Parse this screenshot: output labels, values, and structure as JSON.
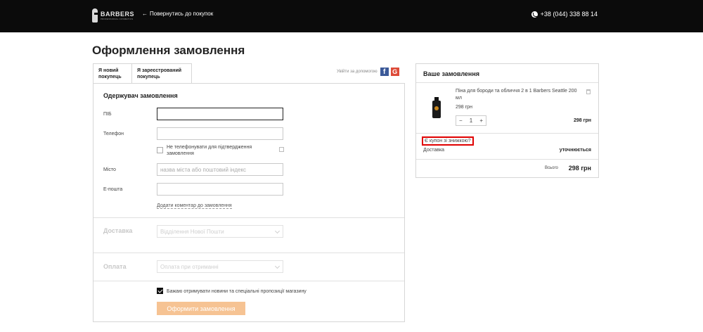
{
  "header": {
    "logo_main": "BARBERS",
    "logo_sub": "PROFESSIONAL COSMETICS",
    "back_label": "Повернутись до покупок",
    "phone": "+38 (044) 338 88 14"
  },
  "page": {
    "title": "Оформлення замовлення"
  },
  "tabs": [
    {
      "label": "Я новий покупець",
      "active": true
    },
    {
      "label": "Я зареєстрований покупець",
      "active": false
    }
  ],
  "social": {
    "label": "Увійти за допомогою",
    "facebook_icon": "facebook-icon",
    "google_icon": "google-icon"
  },
  "recipient": {
    "title": "Одержувач замовлення",
    "name_label": "ПІБ",
    "name_value": "",
    "phone_label": "Телефон",
    "phone_value": "",
    "no_call_label": "Не телефонувати для підтвердження замовлення",
    "city_label": "Місто",
    "city_placeholder": "назва міста або поштовий індекс",
    "email_label": "E-пошта",
    "email_value": "",
    "comment_link": "Додати коментар до замовлення"
  },
  "delivery": {
    "title": "Доставка",
    "selected": "Відділення Нової Пошти"
  },
  "payment": {
    "title": "Оплата",
    "selected": "Оплата при отриманні"
  },
  "newsletter": {
    "label": "Бажаю отримувати новини та спеціальні пропозиції магазину",
    "checked": true
  },
  "submit_label": "Оформити замовлення",
  "order": {
    "title": "Ваше замовлення",
    "item": {
      "name": "Піна для бороди та обличчя 2 в 1 Barbers Seattle 200 мл",
      "unit_price": "298 грн",
      "qty_minus": "−",
      "qty": "1",
      "qty_plus": "+",
      "line_total": "298 грн"
    },
    "coupon_link": "Є купон зі знижкою?",
    "delivery_label": "Доставка",
    "delivery_value": "уточнюється",
    "total_label": "Всього",
    "total_value": "298 грн"
  }
}
